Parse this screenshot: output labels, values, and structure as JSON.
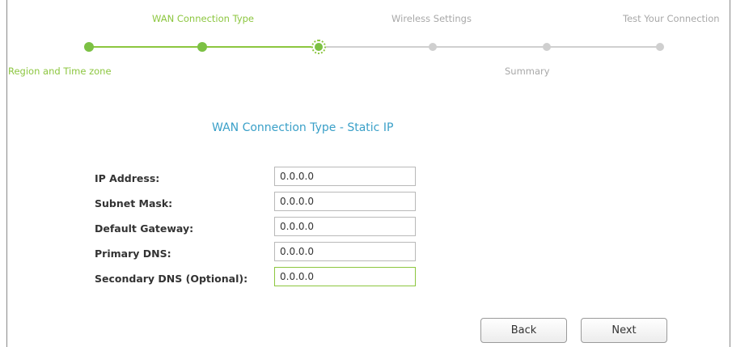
{
  "wizard": {
    "steps": [
      {
        "label": "Region and Time zone",
        "status": "done"
      },
      {
        "label": "WAN Connection Type",
        "status": "current"
      },
      {
        "label": "Wireless Settings",
        "status": "todo"
      },
      {
        "label": "Summary",
        "status": "todo"
      },
      {
        "label": "Test Your Connection",
        "status": "todo"
      }
    ],
    "colors": {
      "done": "#8cc63f",
      "todo": "#cfcfcf",
      "title": "#3aa0c8"
    }
  },
  "form": {
    "title": "WAN Connection Type - Static IP",
    "fields": [
      {
        "label": "IP Address:",
        "value": "0.0.0.0"
      },
      {
        "label": "Subnet Mask:",
        "value": "0.0.0.0"
      },
      {
        "label": "Default Gateway:",
        "value": "0.0.0.0"
      },
      {
        "label": "Primary DNS:",
        "value": "0.0.0.0"
      },
      {
        "label": "Secondary DNS (Optional):",
        "value": "0.0.0.0"
      }
    ]
  },
  "buttons": {
    "back": "Back",
    "next": "Next"
  }
}
